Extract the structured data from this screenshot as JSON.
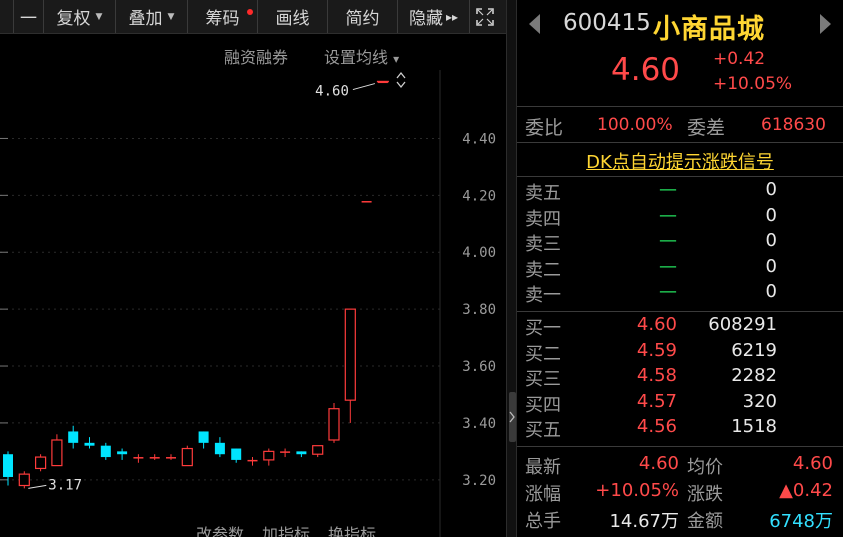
{
  "toolbar": {
    "items": [
      {
        "label": "一",
        "caret": false
      },
      {
        "label": "复权",
        "caret": true
      },
      {
        "label": "叠加",
        "caret": true
      },
      {
        "label": "筹码",
        "caret": false,
        "dot": true
      },
      {
        "label": "画线",
        "caret": false
      },
      {
        "label": "简约",
        "caret": false
      },
      {
        "label": "隐藏",
        "caret": false,
        "arrows": "▸▸"
      }
    ]
  },
  "chart_header": {
    "link_margin": "融资融券",
    "link_ma": "设置均线",
    "ma_caret": "▾"
  },
  "chart_bottom": {
    "items": [
      "改参数",
      "加指标",
      "换指标"
    ]
  },
  "chart_data": {
    "type": "candlestick",
    "y_ticks": [
      "4.40",
      "4.20",
      "4.00",
      "3.80",
      "3.60",
      "3.40",
      "3.20"
    ],
    "ylim": [
      3.115,
      4.5
    ],
    "high_label": "4.60",
    "low_label": "3.17",
    "candles": [
      {
        "o": 3.29,
        "c": 3.21,
        "h": 3.3,
        "l": 3.18
      },
      {
        "o": 3.18,
        "c": 3.22,
        "h": 3.23,
        "l": 3.17
      },
      {
        "o": 3.24,
        "c": 3.28,
        "h": 3.29,
        "l": 3.23
      },
      {
        "o": 3.25,
        "c": 3.34,
        "h": 3.36,
        "l": 3.25
      },
      {
        "o": 3.37,
        "c": 3.33,
        "h": 3.39,
        "l": 3.31
      },
      {
        "o": 3.33,
        "c": 3.32,
        "h": 3.35,
        "l": 3.31
      },
      {
        "o": 3.32,
        "c": 3.28,
        "h": 3.33,
        "l": 3.27
      },
      {
        "o": 3.3,
        "c": 3.29,
        "h": 3.31,
        "l": 3.27
      },
      {
        "o": 3.28,
        "c": 3.28,
        "h": 3.29,
        "l": 3.26
      },
      {
        "o": 3.28,
        "c": 3.28,
        "h": 3.29,
        "l": 3.27
      },
      {
        "o": 3.28,
        "c": 3.28,
        "h": 3.29,
        "l": 3.27
      },
      {
        "o": 3.25,
        "c": 3.31,
        "h": 3.32,
        "l": 3.25
      },
      {
        "o": 3.37,
        "c": 3.33,
        "h": 3.37,
        "l": 3.31
      },
      {
        "o": 3.33,
        "c": 3.29,
        "h": 3.35,
        "l": 3.28
      },
      {
        "o": 3.31,
        "c": 3.27,
        "h": 3.31,
        "l": 3.26
      },
      {
        "o": 3.27,
        "c": 3.27,
        "h": 3.28,
        "l": 3.25
      },
      {
        "o": 3.27,
        "c": 3.3,
        "h": 3.31,
        "l": 3.25
      },
      {
        "o": 3.3,
        "c": 3.3,
        "h": 3.31,
        "l": 3.28
      },
      {
        "o": 3.3,
        "c": 3.29,
        "h": 3.3,
        "l": 3.28
      },
      {
        "o": 3.29,
        "c": 3.32,
        "h": 3.32,
        "l": 3.28
      },
      {
        "o": 3.34,
        "c": 3.45,
        "h": 3.47,
        "l": 3.33
      },
      {
        "o": 3.48,
        "c": 3.8,
        "h": 3.8,
        "l": 3.4
      },
      {
        "o": 4.18,
        "c": 4.18,
        "h": 4.18,
        "l": 4.18
      },
      {
        "o": 4.6,
        "c": 4.6,
        "h": 4.6,
        "l": 4.6
      }
    ],
    "colors": {
      "up": "#ff3b3b",
      "down": "#00e5ff",
      "axis": "#9a9a9a",
      "grid": "#2a2a2a"
    }
  },
  "quote": {
    "code": "600415",
    "name": "小商品城",
    "price": "4.60",
    "change": "+0.42",
    "change_pct": "+10.05%",
    "weibi_label": "委比",
    "weibi_value": "100.00%",
    "weicha_label": "委差",
    "weicha_value": "618630",
    "dk_link": "DK点自动提示涨跌信号",
    "asks": [
      {
        "label": "卖五",
        "price": "—",
        "vol": "0"
      },
      {
        "label": "卖四",
        "price": "—",
        "vol": "0"
      },
      {
        "label": "卖三",
        "price": "—",
        "vol": "0"
      },
      {
        "label": "卖二",
        "price": "—",
        "vol": "0"
      },
      {
        "label": "卖一",
        "price": "—",
        "vol": "0"
      }
    ],
    "bids": [
      {
        "label": "买一",
        "price": "4.60",
        "vol": "608291"
      },
      {
        "label": "买二",
        "price": "4.59",
        "vol": "6219"
      },
      {
        "label": "买三",
        "price": "4.58",
        "vol": "2282"
      },
      {
        "label": "买四",
        "price": "4.57",
        "vol": "320"
      },
      {
        "label": "买五",
        "price": "4.56",
        "vol": "1518"
      }
    ],
    "stats": [
      {
        "l1": "最新",
        "v1": "4.60",
        "l2": "均价",
        "v2": "4.60"
      },
      {
        "l1": "涨幅",
        "v1": "+10.05%",
        "l2": "涨跌",
        "v2": "▲0.42"
      },
      {
        "l1": "总手",
        "v1": "14.67万",
        "l2": "金额",
        "v2": "6748万"
      }
    ]
  },
  "colors": {
    "up": "#ff4a4a",
    "down": "#23e05d",
    "name": "#ffd633",
    "bg": "#000000"
  }
}
